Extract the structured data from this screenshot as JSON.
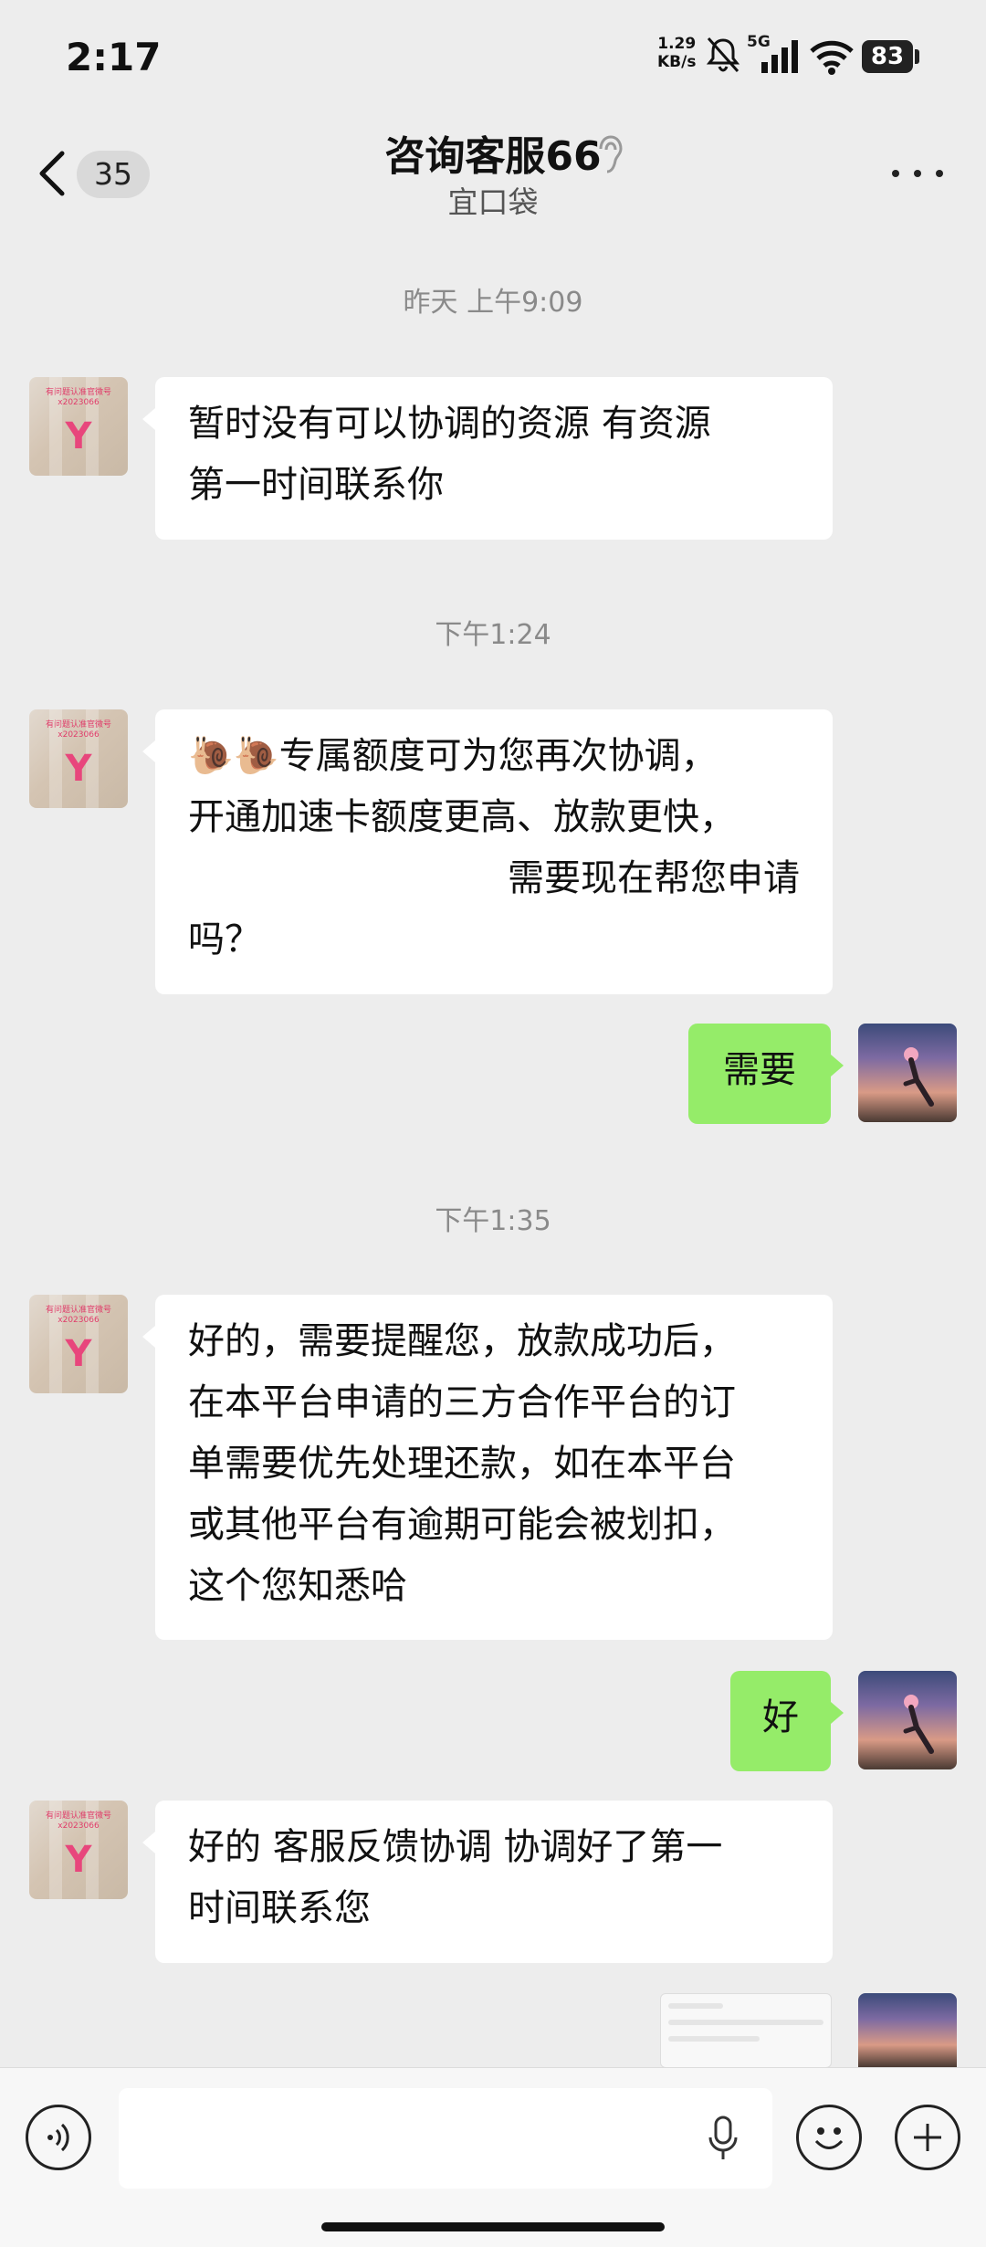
{
  "status_bar": {
    "time": "2:17",
    "net_speed_value": "1.29",
    "net_speed_unit": "KB/s",
    "network": "5G",
    "battery": "83"
  },
  "header": {
    "unread_count": "35",
    "title": "咨询客服66",
    "subtitle": "宜口袋"
  },
  "messages": {
    "ts1": "昨天 上午9:09",
    "msg1_line1": "暂时没有可以协调的资源  有资源",
    "msg1_line2": "第一时间联系你",
    "ts2": "下午1:24",
    "msg2_emoji": "🐌🐌",
    "msg2_line1": "专属额度可为您再次协调，",
    "msg2_line2": "开通加速卡额度更高、放款更快，",
    "msg2_line3": "需要现在帮您申请",
    "msg2_line4": "吗？",
    "reply1": "需要",
    "ts3": "下午1:35",
    "msg3_line1": "好的，需要提醒您，放款成功后，",
    "msg3_line2": "在本平台申请的三方合作平台的订",
    "msg3_line3": "单需要优先处理还款，如在本平台",
    "msg3_line4": "或其他平台有逾期可能会被划扣，",
    "msg3_line5": "这个您知悉哈",
    "reply2": "好",
    "msg4_line1": "好的 客服反馈协调  协调好了第一",
    "msg4_line2": "时间联系您"
  },
  "avatar_text": {
    "bot_tiny": "有问题认准官微号 x2023066",
    "bot_logo": "Y"
  },
  "colors": {
    "background": "#ededed",
    "incoming_bubble": "#ffffff",
    "outgoing_bubble": "#95ec69"
  }
}
